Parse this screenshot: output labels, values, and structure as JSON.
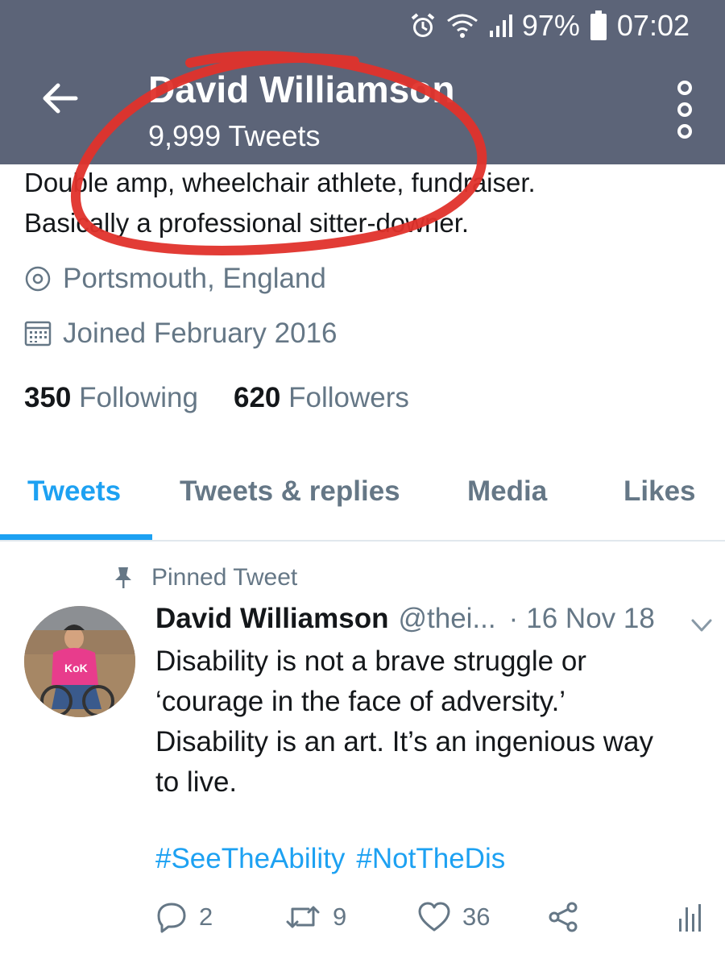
{
  "status_bar": {
    "icons": [
      "alarm-icon",
      "wifi-icon",
      "signal-icon",
      "battery-icon"
    ],
    "battery": "97%",
    "time": "07:02"
  },
  "app_bar": {
    "title": "David Williamson",
    "subtitle": "9,999 Tweets",
    "background_color": "#5c6478"
  },
  "profile": {
    "bio_line1": "Double amp, wheelchair athlete, fundraiser.",
    "bio_line2": "Basically a professional sitter-downer.",
    "location": "Portsmouth, England",
    "joined": "Joined February 2016",
    "following_count": "350",
    "following_label": "Following",
    "followers_count": "620",
    "followers_label": "Followers"
  },
  "tabs": [
    {
      "label": "Tweets",
      "active": true
    },
    {
      "label": "Tweets & replies",
      "active": false
    },
    {
      "label": "Media",
      "active": false
    },
    {
      "label": "Likes",
      "active": false
    }
  ],
  "tweet": {
    "pinned_label": "Pinned Tweet",
    "author_name": "David Williamson",
    "handle": "@thei...",
    "separator": "·",
    "date": "16 Nov 18",
    "body_line1": "Disability is not a brave struggle or",
    "body_line2": "‘courage in the face of adversity.’",
    "body_line3": "Disability is an art. It’s an ingenious way",
    "body_line4": "to live.",
    "hashtags": [
      "#SeeTheAbility",
      "#NotTheDis"
    ],
    "replies": "2",
    "retweets": "9",
    "likes": "36"
  },
  "colors": {
    "accent": "#1da1f2",
    "secondary_text": "#657786",
    "annotation_red": "#e0312b"
  }
}
